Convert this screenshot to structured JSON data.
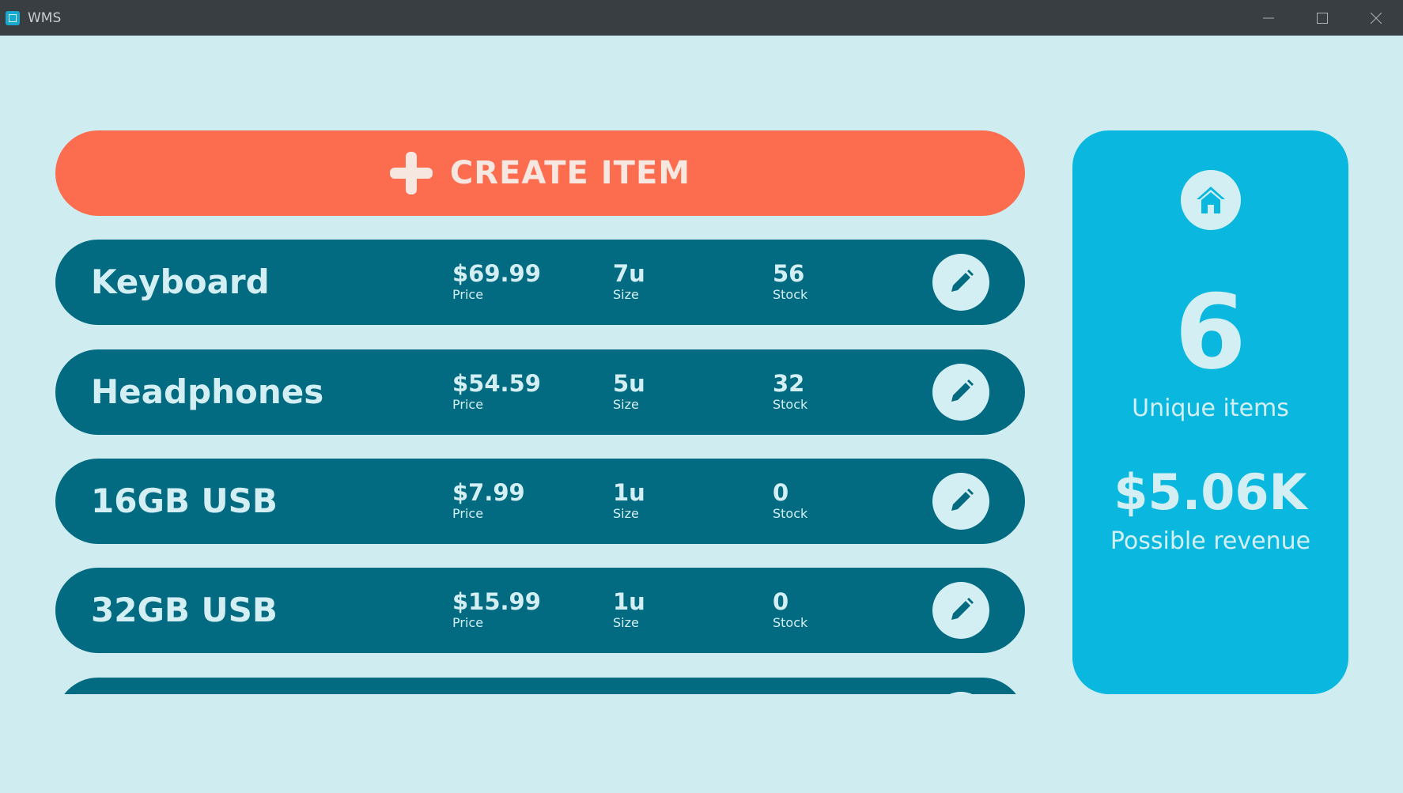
{
  "window": {
    "title": "WMS",
    "icon": "app-icon",
    "controls": [
      "minimize-icon",
      "maximize-icon",
      "close-icon"
    ]
  },
  "create_button": {
    "label": "CREATE ITEM",
    "icon": "plus-icon"
  },
  "items": [
    {
      "name": "Keyboard",
      "price": "$69.99",
      "price_label": "Price",
      "size": "7u",
      "size_label": "Size",
      "stock": "56",
      "stock_label": "Stock"
    },
    {
      "name": "Headphones",
      "price": "$54.59",
      "price_label": "Price",
      "size": "5u",
      "size_label": "Size",
      "stock": "32",
      "stock_label": "Stock"
    },
    {
      "name": "16GB USB",
      "price": "$7.99",
      "price_label": "Price",
      "size": "1u",
      "size_label": "Size",
      "stock": "0",
      "stock_label": "Stock"
    },
    {
      "name": "32GB USB",
      "price": "$15.99",
      "price_label": "Price",
      "size": "1u",
      "size_label": "Size",
      "stock": "0",
      "stock_label": "Stock"
    }
  ],
  "summary": {
    "home_icon": "home-icon",
    "unique_count": "6",
    "unique_label": "Unique items",
    "revenue_value": "$5.06K",
    "revenue_label": "Possible revenue"
  },
  "colors": {
    "background": "#cfedf1",
    "titlebar": "#393e42",
    "create_button": "#fc6c4f",
    "item_row": "#026b81",
    "side_panel": "#0ab8df",
    "light_text": "#d3eff3"
  }
}
